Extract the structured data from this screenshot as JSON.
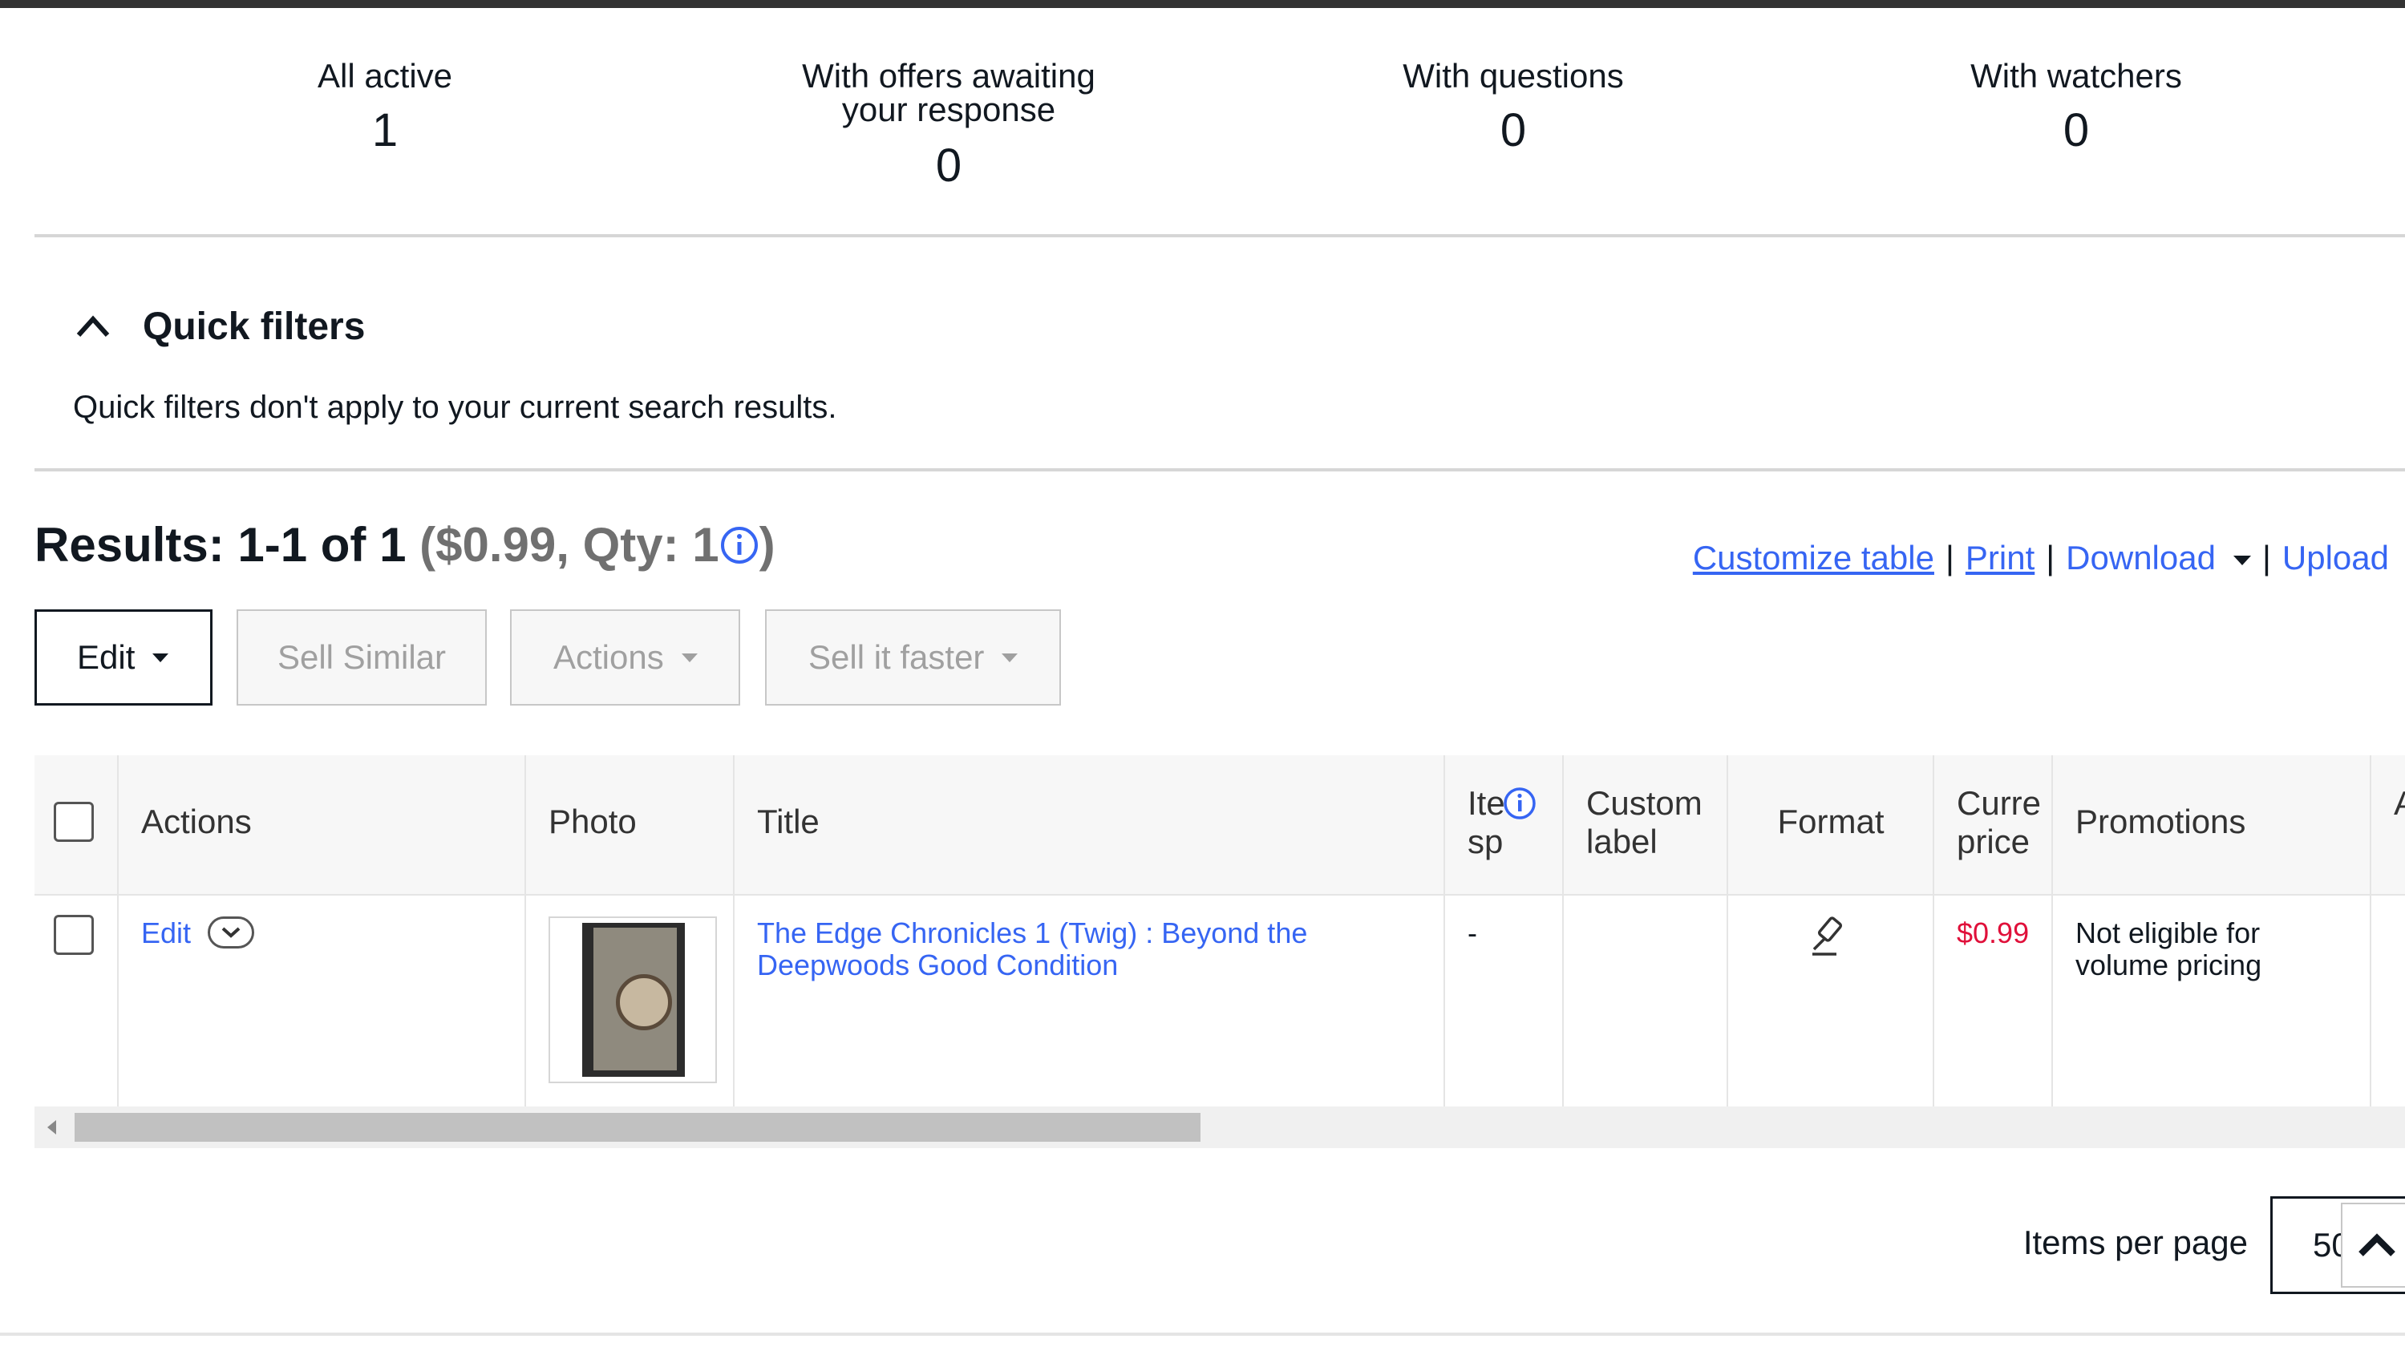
{
  "summary": [
    {
      "label": "All active",
      "value": "1"
    },
    {
      "label": "With offers awaiting your response",
      "value": "0"
    },
    {
      "label": "With questions",
      "value": "0"
    },
    {
      "label": "With watchers",
      "value": "0"
    }
  ],
  "quick_filters": {
    "title": "Quick filters",
    "message": "Quick filters don't apply to your current search results."
  },
  "results": {
    "label": "Results: 1-1 of 1",
    "summary_open": "($0.99, Qty: 1",
    "summary_close": ")"
  },
  "links": {
    "customize": "Customize table",
    "print": "Print",
    "download": "Download",
    "upload": "Upload",
    "separator": "|"
  },
  "toolbar": {
    "edit": "Edit",
    "sell_similar": "Sell Similar",
    "actions": "Actions",
    "sell_faster": "Sell it faster"
  },
  "table": {
    "headers": {
      "actions": "Actions",
      "photo": "Photo",
      "title": "Title",
      "item_specifics_1": "Ite",
      "item_specifics_2": "sp",
      "custom_label_1": "Custom",
      "custom_label_2": "label",
      "format": "Format",
      "current_price_1": "Curre",
      "current_price_2": "price",
      "promotions": "Promotions",
      "next": "A"
    },
    "rows": [
      {
        "action": "Edit",
        "title_line1": "The Edge Chronicles 1 (Twig) : Beyond the",
        "title_line2": "Deepwoods Good Condition",
        "item_specifics": "-",
        "custom_label": "",
        "format_icon": "gavel-icon",
        "price": "$0.99",
        "promotions_line1": "Not eligible for",
        "promotions_line2": "volume pricing"
      }
    ]
  },
  "pagination": {
    "label": "Items per page",
    "value": "50"
  },
  "colors": {
    "link": "#3665f3",
    "price": "#e0103a",
    "text": "#111820"
  }
}
